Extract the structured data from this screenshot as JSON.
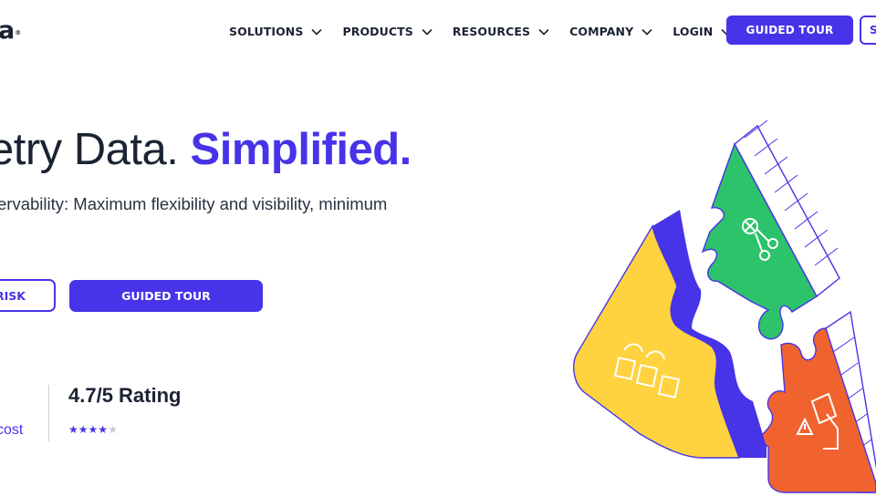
{
  "brand": {
    "logo_text": "a",
    "logo_mark": "®"
  },
  "nav": {
    "items": [
      {
        "label": "SOLUTIONS"
      },
      {
        "label": "PRODUCTS"
      },
      {
        "label": "RESOURCES"
      },
      {
        "label": "COMPANY"
      },
      {
        "label": "LOGIN"
      }
    ],
    "guided_tour_label": "GUIDED TOUR",
    "secondary_label": "S"
  },
  "hero": {
    "title_plain": "etry Data. ",
    "title_accent": "Simplified.",
    "subtitle": "ervability: Maximum flexibility and visibility, minimum",
    "risk_button_label": "RISK",
    "guided_tour_label": "GUIDED TOUR",
    "cost_text": "cost",
    "rating_text": "4.7/5 Rating",
    "rating_value": 4.7,
    "rating_max": 5
  },
  "colors": {
    "accent": "#4733e8",
    "yellow": "#ffd23f",
    "green": "#2cc36b",
    "orange": "#f0632f"
  },
  "icons": [
    "chevron-down-icon",
    "star-icon",
    "puzzle-illustration"
  ]
}
